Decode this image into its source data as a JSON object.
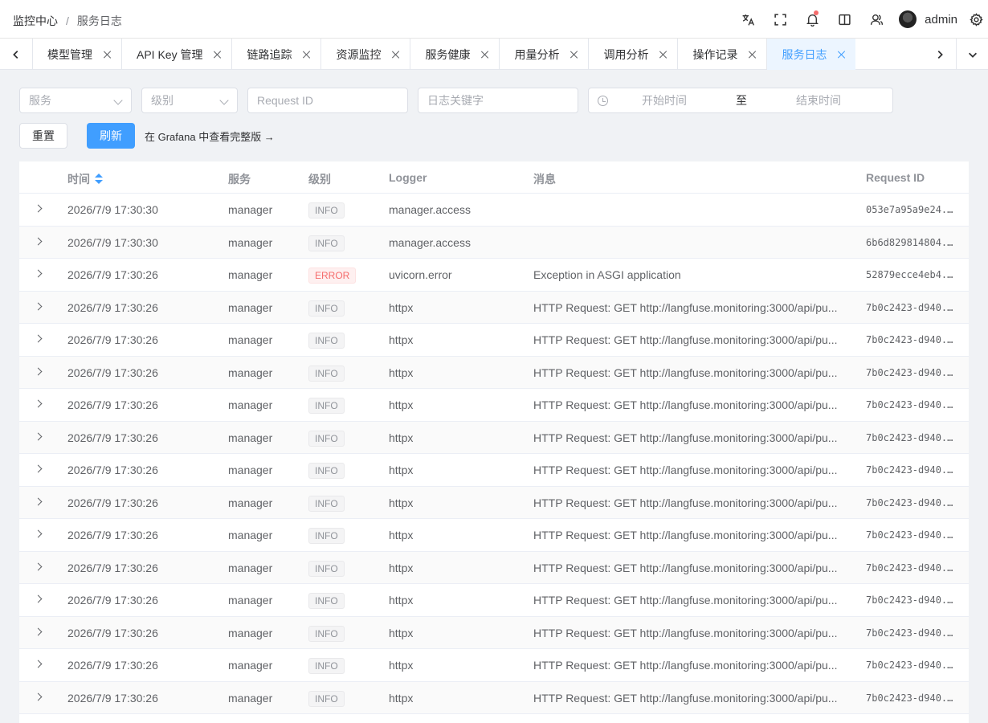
{
  "breadcrumb": {
    "root": "监控中心",
    "sep": "/",
    "current": "服务日志"
  },
  "header": {
    "username": "admin"
  },
  "tabs": [
    {
      "label": "模型管理"
    },
    {
      "label": "API Key 管理"
    },
    {
      "label": "链路追踪"
    },
    {
      "label": "资源监控"
    },
    {
      "label": "服务健康"
    },
    {
      "label": "用量分析"
    },
    {
      "label": "调用分析"
    },
    {
      "label": "操作记录"
    },
    {
      "label": "服务日志"
    }
  ],
  "filters": {
    "service_placeholder": "服务",
    "level_placeholder": "级别",
    "request_id_placeholder": "Request ID",
    "keyword_placeholder": "日志关键字",
    "start_placeholder": "开始时间",
    "range_separator": "至",
    "end_placeholder": "结束时间"
  },
  "actions": {
    "reset": "重置",
    "refresh": "刷新",
    "grafana_link": "在 Grafana 中查看完整版 →"
  },
  "table": {
    "headers": {
      "time": "时间",
      "service": "服务",
      "level": "级别",
      "logger": "Logger",
      "message": "消息",
      "request_id": "Request ID"
    },
    "rows": [
      {
        "time": "2026/7/9 17:30:30",
        "service": "manager",
        "level": "INFO",
        "logger": "manager.access",
        "message": "",
        "request_id": "053e7a95a9e24..."
      },
      {
        "time": "2026/7/9 17:30:30",
        "service": "manager",
        "level": "INFO",
        "logger": "manager.access",
        "message": "",
        "request_id": "6b6d829814804..."
      },
      {
        "time": "2026/7/9 17:30:26",
        "service": "manager",
        "level": "ERROR",
        "logger": "uvicorn.error",
        "message": "Exception in ASGI application",
        "request_id": "52879ecce4eb4..."
      },
      {
        "time": "2026/7/9 17:30:26",
        "service": "manager",
        "level": "INFO",
        "logger": "httpx",
        "message": "HTTP Request: GET http://langfuse.monitoring:3000/api/pu...",
        "request_id": "7b0c2423-d940..."
      },
      {
        "time": "2026/7/9 17:30:26",
        "service": "manager",
        "level": "INFO",
        "logger": "httpx",
        "message": "HTTP Request: GET http://langfuse.monitoring:3000/api/pu...",
        "request_id": "7b0c2423-d940..."
      },
      {
        "time": "2026/7/9 17:30:26",
        "service": "manager",
        "level": "INFO",
        "logger": "httpx",
        "message": "HTTP Request: GET http://langfuse.monitoring:3000/api/pu...",
        "request_id": "7b0c2423-d940..."
      },
      {
        "time": "2026/7/9 17:30:26",
        "service": "manager",
        "level": "INFO",
        "logger": "httpx",
        "message": "HTTP Request: GET http://langfuse.monitoring:3000/api/pu...",
        "request_id": "7b0c2423-d940..."
      },
      {
        "time": "2026/7/9 17:30:26",
        "service": "manager",
        "level": "INFO",
        "logger": "httpx",
        "message": "HTTP Request: GET http://langfuse.monitoring:3000/api/pu...",
        "request_id": "7b0c2423-d940..."
      },
      {
        "time": "2026/7/9 17:30:26",
        "service": "manager",
        "level": "INFO",
        "logger": "httpx",
        "message": "HTTP Request: GET http://langfuse.monitoring:3000/api/pu...",
        "request_id": "7b0c2423-d940..."
      },
      {
        "time": "2026/7/9 17:30:26",
        "service": "manager",
        "level": "INFO",
        "logger": "httpx",
        "message": "HTTP Request: GET http://langfuse.monitoring:3000/api/pu...",
        "request_id": "7b0c2423-d940..."
      },
      {
        "time": "2026/7/9 17:30:26",
        "service": "manager",
        "level": "INFO",
        "logger": "httpx",
        "message": "HTTP Request: GET http://langfuse.monitoring:3000/api/pu...",
        "request_id": "7b0c2423-d940..."
      },
      {
        "time": "2026/7/9 17:30:26",
        "service": "manager",
        "level": "INFO",
        "logger": "httpx",
        "message": "HTTP Request: GET http://langfuse.monitoring:3000/api/pu...",
        "request_id": "7b0c2423-d940..."
      },
      {
        "time": "2026/7/9 17:30:26",
        "service": "manager",
        "level": "INFO",
        "logger": "httpx",
        "message": "HTTP Request: GET http://langfuse.monitoring:3000/api/pu...",
        "request_id": "7b0c2423-d940..."
      },
      {
        "time": "2026/7/9 17:30:26",
        "service": "manager",
        "level": "INFO",
        "logger": "httpx",
        "message": "HTTP Request: GET http://langfuse.monitoring:3000/api/pu...",
        "request_id": "7b0c2423-d940..."
      },
      {
        "time": "2026/7/9 17:30:26",
        "service": "manager",
        "level": "INFO",
        "logger": "httpx",
        "message": "HTTP Request: GET http://langfuse.monitoring:3000/api/pu...",
        "request_id": "7b0c2423-d940..."
      },
      {
        "time": "2026/7/9 17:30:26",
        "service": "manager",
        "level": "INFO",
        "logger": "httpx",
        "message": "HTTP Request: GET http://langfuse.monitoring:3000/api/pu...",
        "request_id": "7b0c2423-d940..."
      }
    ]
  },
  "colors": {
    "primary": "#409eff",
    "error": "#f56c6c",
    "info_tag": "#909399"
  },
  "icons": [
    "translate-icon",
    "fullscreen-icon",
    "bell-icon",
    "book-icon",
    "users-icon",
    "settings-icon"
  ]
}
